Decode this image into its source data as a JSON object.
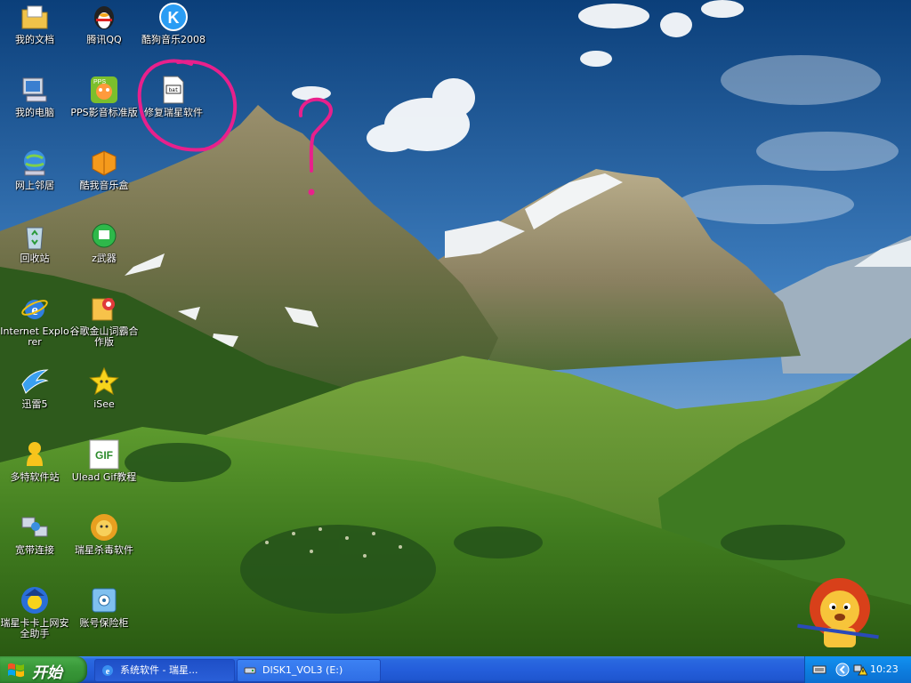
{
  "desktop": {
    "icons": [
      {
        "label": "我的文档",
        "icon": "my-documents-folder-icon"
      },
      {
        "label": "腾讯QQ",
        "icon": "qq-penguin-icon"
      },
      {
        "label": "酷狗音乐2008",
        "icon": "kugou-music-icon"
      },
      {
        "label": "我的电脑",
        "icon": "my-computer-icon"
      },
      {
        "label": "PPS影音标准版",
        "icon": "pps-player-icon"
      },
      {
        "label": "修复瑞星软件",
        "icon": "repair-rising-file-icon"
      },
      {
        "label": "网上邻居",
        "icon": "network-places-icon"
      },
      {
        "label": "酷我音乐盒",
        "icon": "kuwo-music-box-icon"
      },
      {
        "label": "回收站",
        "icon": "recycle-bin-icon"
      },
      {
        "label": "z武器",
        "icon": "green-circle-app-icon"
      },
      {
        "label": "Internet Explorer",
        "icon": "internet-explorer-icon"
      },
      {
        "label": "谷歌金山词霸合作版",
        "icon": "kingsoft-dictionary-icon"
      },
      {
        "label": "迅雷5",
        "icon": "thunder-download-icon"
      },
      {
        "label": "iSee",
        "icon": "isee-star-icon"
      },
      {
        "label": "多特软件站",
        "icon": "duote-software-icon"
      },
      {
        "label": "Ulead Gif教程",
        "icon": "gif-icon"
      },
      {
        "label": "宽带连接",
        "icon": "broadband-connection-icon"
      },
      {
        "label": "瑞星杀毒软件",
        "icon": "rising-antivirus-lion-icon"
      },
      {
        "label": "瑞星卡卡上网安全助手",
        "icon": "rising-kaka-assistant-icon"
      },
      {
        "label": "账号保险柜",
        "icon": "account-safe-icon"
      }
    ],
    "annotation": {
      "mark": "?"
    }
  },
  "taskbar": {
    "start_label": "开始",
    "tasks": [
      {
        "label": "系统软件 - 瑞星...",
        "icon": "internet-explorer-icon"
      },
      {
        "label": "DISK1_VOL3 (E:)",
        "icon": "drive-icon"
      }
    ],
    "tray_icons": [
      "keyboard-icon",
      "show-hidden-icons-arrow-icon",
      "network-warning-icon"
    ],
    "clock": "10:23"
  },
  "colors": {
    "taskbar_blue": "#245edb",
    "start_green": "#3a9a3a",
    "annotation_pink": "#e8208c",
    "tray_blue": "#0d7fe0"
  }
}
